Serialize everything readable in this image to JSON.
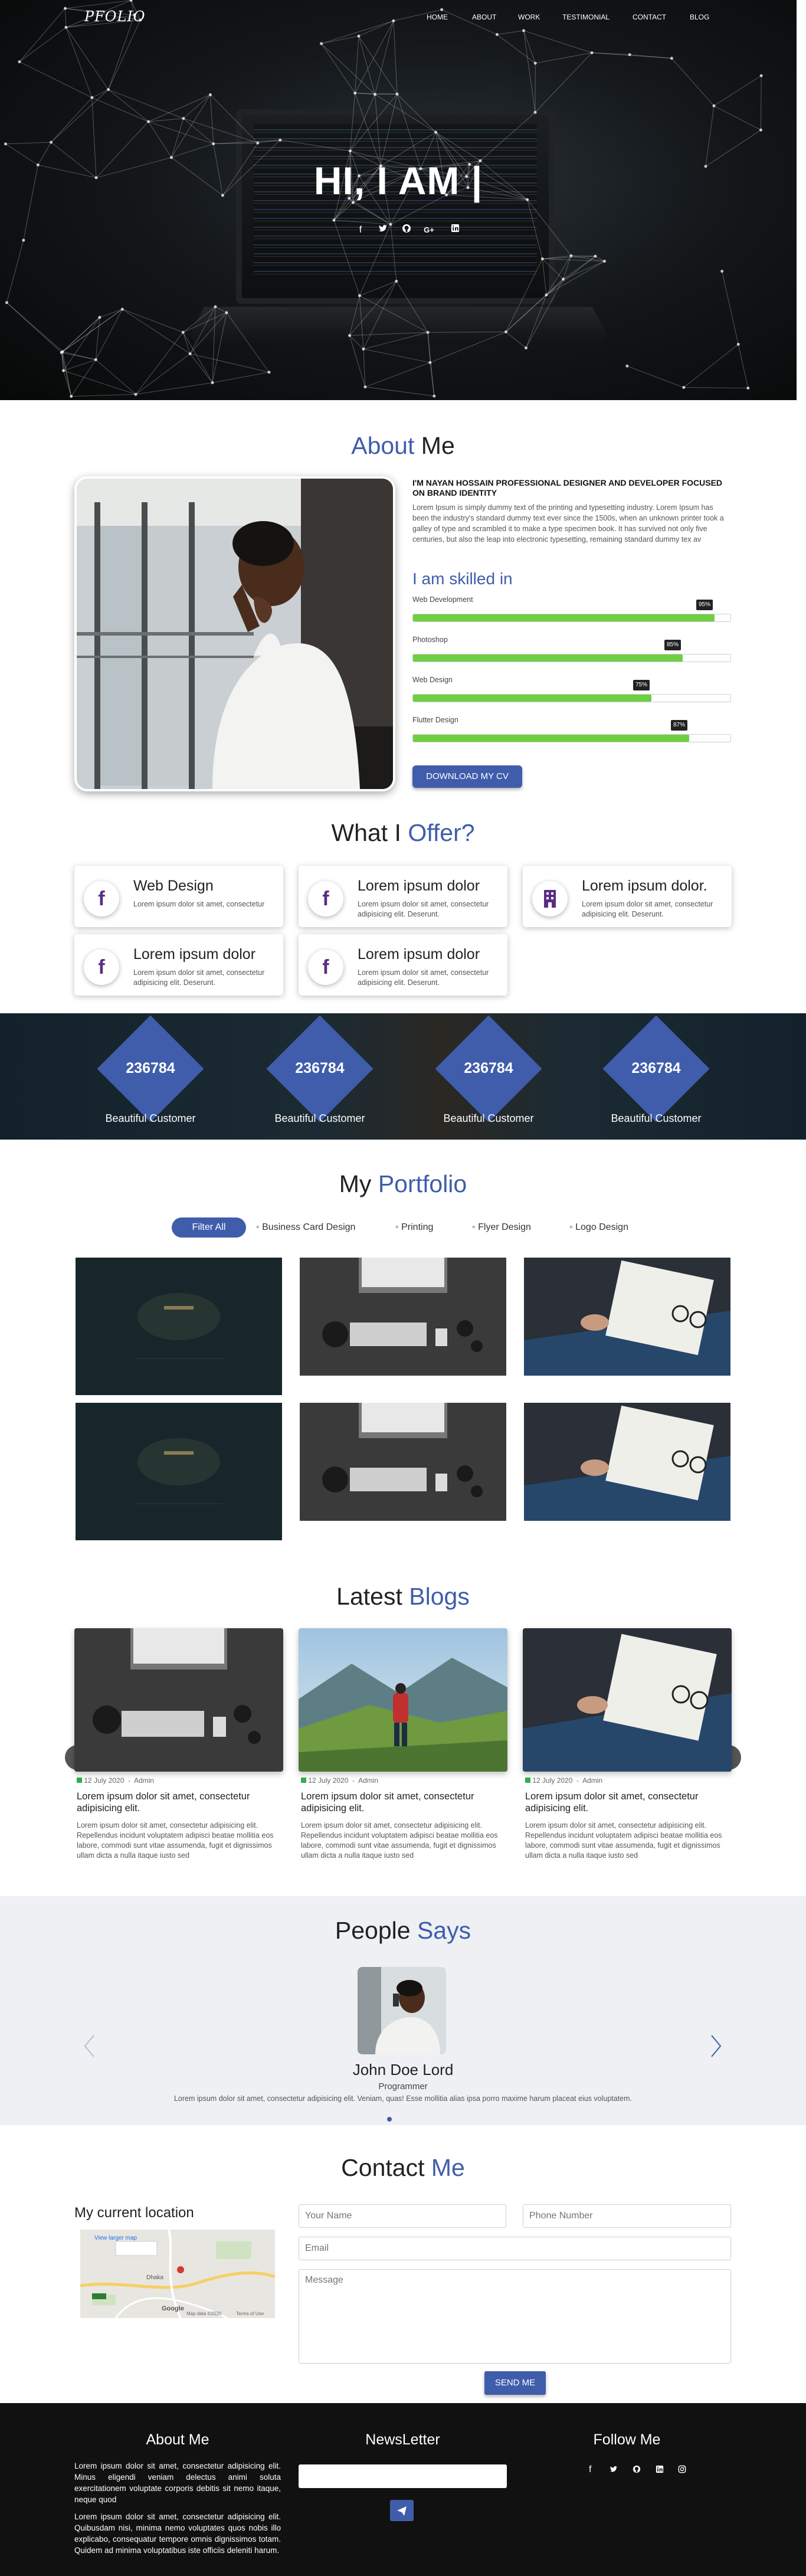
{
  "brand": {
    "logo": "PFOLIO"
  },
  "nav": [
    "HOME",
    "ABOUT",
    "WORK",
    "TESTIMONIAL",
    "CONTACT",
    "BLOG"
  ],
  "hero": {
    "title": "HI, I AM |",
    "social_icons": [
      "facebook-icon",
      "twitter-icon",
      "github-icon",
      "google-plus-icon",
      "linkedin-icon"
    ]
  },
  "about": {
    "title_accent": "About",
    "title_rest": "Me",
    "heading": "I'M NAYAN HOSSAIN PROFESSIONAL DESIGNER AND DEVELOPER FOCUSED ON BRAND IDENTITY",
    "text": "Lorem Ipsum is simply dummy text of the printing and typesetting industry. Lorem Ipsum has been the industry's standard dummy text ever since the 1500s, when an unknown printer took a galley of type and scrambled it to make a type specimen book. It has survived not only five centuries, but also the leap into electronic typesetting, remaining standard dummy tex av",
    "skills_title": "I am skilled in",
    "skills": [
      {
        "name": "Web Development",
        "percent": 95,
        "label": "95%"
      },
      {
        "name": "Photoshop",
        "percent": 85,
        "label": "85%"
      },
      {
        "name": "Web Design",
        "percent": 75,
        "label": "75%"
      },
      {
        "name": "Flutter Design",
        "percent": 87,
        "label": "87%"
      }
    ],
    "cv_button": "DOWNLOAD MY CV"
  },
  "offer": {
    "title_rest": "What I",
    "title_accent": "Offer?",
    "cards": [
      {
        "icon": "facebook-icon",
        "title": "Web Design",
        "text": "Lorem ipsum dolor sit amet, consectetur"
      },
      {
        "icon": "facebook-icon",
        "title": "Lorem ipsum dolor",
        "text": "Lorem ipsum dolor sit amet, consectetur adipisicing elit. Deserunt."
      },
      {
        "icon": "building-icon",
        "title": "Lorem ipsum dolor.",
        "text": "Lorem ipsum dolor sit amet, consectetur adipisicing elit. Deserunt."
      },
      {
        "icon": "facebook-icon",
        "title": "Lorem ipsum dolor",
        "text": "Lorem ipsum dolor sit amet, consectetur adipisicing elit. Deserunt."
      },
      {
        "icon": "facebook-icon",
        "title": "Lorem ipsum dolor",
        "text": "Lorem ipsum dolor sit amet, consectetur adipisicing elit. Deserunt."
      }
    ]
  },
  "counters": [
    {
      "value": "236784",
      "label": "Beautiful Customer"
    },
    {
      "value": "236784",
      "label": "Beautiful Customer"
    },
    {
      "value": "236784",
      "label": "Beautiful Customer"
    },
    {
      "value": "236784",
      "label": "Beautiful Customer"
    }
  ],
  "portfolio": {
    "title_rest": "My",
    "title_accent": "Portfolio",
    "filters": [
      "Filter All",
      "Business Card Design",
      "Printing",
      "Flyer Design",
      "Logo Design"
    ]
  },
  "blogs": {
    "title_rest": "Latest",
    "title_accent": "Blogs",
    "posts": [
      {
        "date": "12 July 2020",
        "author": "Admin",
        "title": "Lorem ipsum dolor sit amet, consectetur adipisicing elit.",
        "text": "Lorem ipsum dolor sit amet, consectetur adipisicing elit. Repellendus incidunt voluptatem adipisci beatae mollitia eos labore, commodi sunt vitae assumenda, fugit et dignissimos ullam dicta a nulla itaque iusto sed"
      },
      {
        "date": "12 July 2020",
        "author": "Admin",
        "title": "Lorem ipsum dolor sit amet, consectetur adipisicing elit.",
        "text": "Lorem ipsum dolor sit amet, consectetur adipisicing elit. Repellendus incidunt voluptatem adipisci beatae mollitia eos labore, commodi sunt vitae assumenda, fugit et dignissimos ullam dicta a nulla itaque iusto sed"
      },
      {
        "date": "12 July 2020",
        "author": "Admin",
        "title": "Lorem ipsum dolor sit amet, consectetur adipisicing elit.",
        "text": "Lorem ipsum dolor sit amet, consectetur adipisicing elit. Repellendus incidunt voluptatem adipisci beatae mollitia eos labore, commodi sunt vitae assumenda, fugit et dignissimos ullam dicta a nulla itaque iusto sed"
      }
    ]
  },
  "testimonial": {
    "title_rest": "People",
    "title_accent": "Says",
    "name": "John Doe Lord",
    "role": "Programmer",
    "text": "Lorem ipsum dolor sit amet, consectetur adipisicing elit. Veniam, quas! Esse mollitia alias ipsa porro maxime harum placeat eius voluptatem."
  },
  "contact": {
    "title_rest": "Contact",
    "title_accent": "Me",
    "location_title": "My current location",
    "map_link": "View larger map",
    "map_labels": [
      "Dhaka",
      "Google",
      "Map data ©2020",
      "Terms of Use"
    ],
    "name_placeholder": "Your Name",
    "phone_placeholder": "Phone Number",
    "email_placeholder": "Email",
    "message_placeholder": "Message",
    "send_button": "SEND ME"
  },
  "footer": {
    "about_title": "About Me",
    "about_text_1": "Lorem ipsum dolor sit amet, consectetur adipisicing elit. Minus eligendi veniam delectus animi soluta exercitationem voluptate corporis debitis sit nemo itaque, neque quod",
    "about_text_2": "Lorem ipsum dolor sit amet, consectetur adipisicing elit. Quibusdam nisi, minima nemo voluptates quos nobis illo explicabo, consequatur tempore omnis dignissimos totam. Quidem ad minima voluptatibus iste officiis deleniti harum.",
    "newsletter_title": "NewsLetter",
    "follow_title": "Follow Me",
    "follow_icons": [
      "facebook-icon",
      "twitter-icon",
      "github-icon",
      "linkedin-icon",
      "instagram-icon"
    ]
  },
  "colors": {
    "accent": "#3f5dab",
    "skill_bar": "#6ecf43",
    "footer_bg": "#111111",
    "testimonial_bg": "#eef0f4"
  }
}
